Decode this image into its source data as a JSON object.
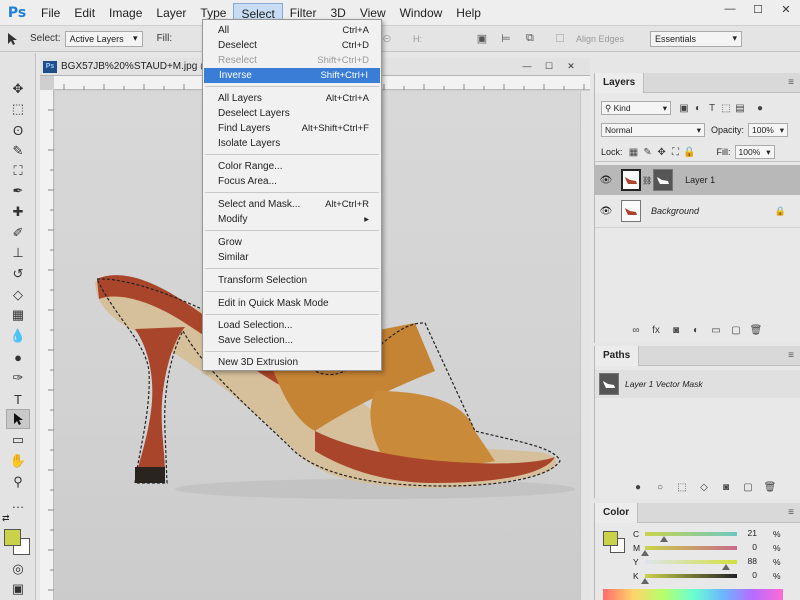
{
  "app": {
    "logo": "Ps",
    "menus": [
      "File",
      "Edit",
      "Image",
      "Layer",
      "Type",
      "Select",
      "Filter",
      "3D",
      "View",
      "Window",
      "Help"
    ],
    "active_menu": "Select",
    "window_controls": [
      "—",
      "☐",
      "✕"
    ]
  },
  "options_bar": {
    "select_label": "Select:",
    "select_value": "Active Layers",
    "fill_label": "Fill:",
    "w_label": "W:",
    "h_label": "H:",
    "align_edges": "Align Edges",
    "workspace": "Essentials"
  },
  "document": {
    "tab_title": "BGX57JB%20%STAUD+M.jpg @ 25",
    "controls": [
      "—",
      "☐",
      "✕"
    ]
  },
  "select_menu": [
    {
      "label": "All",
      "shortcut": "Ctrl+A",
      "state": "normal"
    },
    {
      "label": "Deselect",
      "shortcut": "Ctrl+D",
      "state": "normal"
    },
    {
      "label": "Reselect",
      "shortcut": "Shift+Ctrl+D",
      "state": "disabled"
    },
    {
      "label": "Inverse",
      "shortcut": "Shift+Ctrl+I",
      "state": "highlight"
    },
    {
      "label": "All Layers",
      "shortcut": "Alt+Ctrl+A",
      "state": "normal"
    },
    {
      "label": "Deselect Layers",
      "shortcut": "",
      "state": "normal"
    },
    {
      "label": "Find Layers",
      "shortcut": "Alt+Shift+Ctrl+F",
      "state": "normal"
    },
    {
      "label": "Isolate Layers",
      "shortcut": "",
      "state": "normal"
    },
    {
      "label": "Color Range...",
      "shortcut": "",
      "state": "normal"
    },
    {
      "label": "Focus Area...",
      "shortcut": "",
      "state": "normal"
    },
    {
      "label": "Select and Mask...",
      "shortcut": "Alt+Ctrl+R",
      "state": "normal"
    },
    {
      "label": "Modify",
      "shortcut": "▸",
      "state": "normal"
    },
    {
      "label": "Grow",
      "shortcut": "",
      "state": "normal"
    },
    {
      "label": "Similar",
      "shortcut": "",
      "state": "normal"
    },
    {
      "label": "Transform Selection",
      "shortcut": "",
      "state": "normal"
    },
    {
      "label": "Edit in Quick Mask Mode",
      "shortcut": "",
      "state": "normal"
    },
    {
      "label": "Load Selection...",
      "shortcut": "",
      "state": "normal"
    },
    {
      "label": "Save Selection...",
      "shortcut": "",
      "state": "normal"
    },
    {
      "label": "New 3D Extrusion",
      "shortcut": "",
      "state": "normal"
    }
  ],
  "layers_panel": {
    "title": "Layers",
    "kind": "Kind",
    "blend_mode": "Normal",
    "opacity_label": "Opacity:",
    "opacity_value": "100%",
    "lock_label": "Lock:",
    "fill_label": "Fill:",
    "fill_value": "100%",
    "layers": [
      {
        "name": "Layer 1",
        "selected": true
      },
      {
        "name": "Background",
        "selected": false
      }
    ]
  },
  "paths_panel": {
    "title": "Paths",
    "items": [
      "Layer 1 Vector Mask"
    ]
  },
  "color_panel": {
    "title": "Color",
    "foreground": "#c9d34a",
    "background": "#ffffff",
    "channels": [
      {
        "name": "C",
        "value": "21",
        "unit": "%",
        "level": 0.21
      },
      {
        "name": "M",
        "value": "0",
        "unit": "%",
        "level": 0.0
      },
      {
        "name": "Y",
        "value": "88",
        "unit": "%",
        "level": 0.88
      },
      {
        "name": "K",
        "value": "0",
        "unit": "%",
        "level": 0.0
      }
    ]
  },
  "colors": {
    "menu_highlight": "#3a7dd6",
    "shoe_leather": "#a8452a",
    "shoe_suede": "#c58334"
  }
}
